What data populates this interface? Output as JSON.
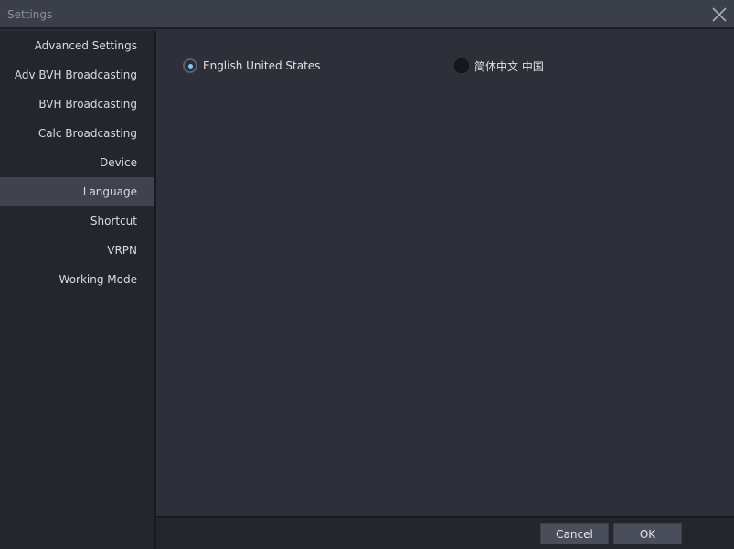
{
  "window": {
    "title": "Settings"
  },
  "sidebar": {
    "items": [
      {
        "label": "Advanced Settings",
        "active": false
      },
      {
        "label": "Adv BVH Broadcasting",
        "active": false
      },
      {
        "label": "BVH Broadcasting",
        "active": false
      },
      {
        "label": "Calc Broadcasting",
        "active": false
      },
      {
        "label": "Device",
        "active": false
      },
      {
        "label": "Language",
        "active": true
      },
      {
        "label": "Shortcut",
        "active": false
      },
      {
        "label": "VRPN",
        "active": false
      },
      {
        "label": "Working Mode",
        "active": false
      }
    ]
  },
  "language": {
    "options": [
      {
        "label": "English United States",
        "selected": true
      },
      {
        "label": "简体中文 中国",
        "selected": false
      }
    ]
  },
  "footer": {
    "cancel_label": "Cancel",
    "ok_label": "OK"
  },
  "colors": {
    "background": "#2b2e36",
    "sidebar": "#23262d",
    "active_item": "#3f4350",
    "radio_accent": "#7ec6ff",
    "button": "#4a4e5b"
  }
}
